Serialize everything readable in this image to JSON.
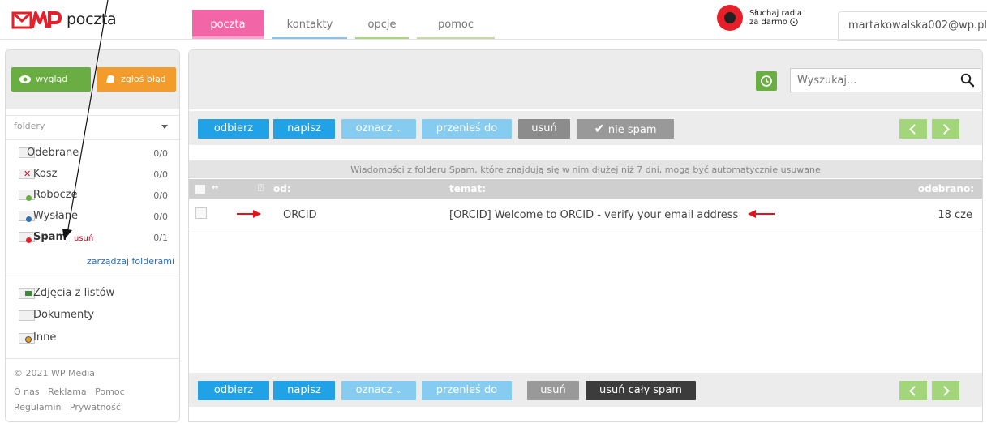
{
  "app": {
    "logo_text": "poczta"
  },
  "tabs": [
    {
      "label": "poczta"
    },
    {
      "label": "kontakty"
    },
    {
      "label": "opcje"
    },
    {
      "label": "pomoc"
    }
  ],
  "radio": {
    "line1": "Słuchaj radia",
    "line2": "za darmo"
  },
  "user": {
    "email": "martakowalska002@wp.pl"
  },
  "sidebar": {
    "buttons": {
      "look": "wygląd",
      "report": "zgłoś błąd"
    },
    "folders_header": "foldery",
    "folders": [
      {
        "name": "Odebrane",
        "count": "0/0"
      },
      {
        "name": "Kosz",
        "count": "0/0"
      },
      {
        "name": "Robocze",
        "count": "0/0"
      },
      {
        "name": "Wysłane",
        "count": "0/0"
      },
      {
        "name": "Spam",
        "count": "0/1",
        "action": "usuń"
      }
    ],
    "manage_link": "zarządzaj folderami",
    "user_folders": [
      {
        "name": "Zdjęcia z listów"
      },
      {
        "name": "Dokumenty"
      },
      {
        "name": "Inne"
      }
    ],
    "copyright": "© 2021 WP Media",
    "links": [
      "O nas",
      "Reklama",
      "Pomoc",
      "Regulamin",
      "Prywatność"
    ]
  },
  "search": {
    "placeholder": "Wyszukaj..."
  },
  "toolbar_top": {
    "receive": "odbierz",
    "compose": "napisz",
    "mark": "oznacz",
    "move": "przenieś do",
    "delete": "usuń",
    "not_spam": "nie spam"
  },
  "toolbar_bottom": {
    "receive": "odbierz",
    "compose": "napisz",
    "mark": "oznacz",
    "move": "przenieś do",
    "delete": "usuń",
    "delete_all_spam": "usuń cały spam"
  },
  "notice": "Wiadomości z folderu Spam, które znajdują się w nim dłużej niż 7 dni, mogą być automatycznie usuwane",
  "columns": {
    "from": "od:",
    "subject": "temat:",
    "received": "odebrano:"
  },
  "messages": [
    {
      "from": "ORCID",
      "subject": "[ORCID] Welcome to ORCID - verify your email address",
      "date": "18 cze"
    }
  ],
  "colors": {
    "accent_pink": "#f266a7",
    "button_blue": "#21a2e6",
    "green": "#6aad42",
    "orange": "#f39c2c",
    "annotation_red": "#e8101a"
  }
}
